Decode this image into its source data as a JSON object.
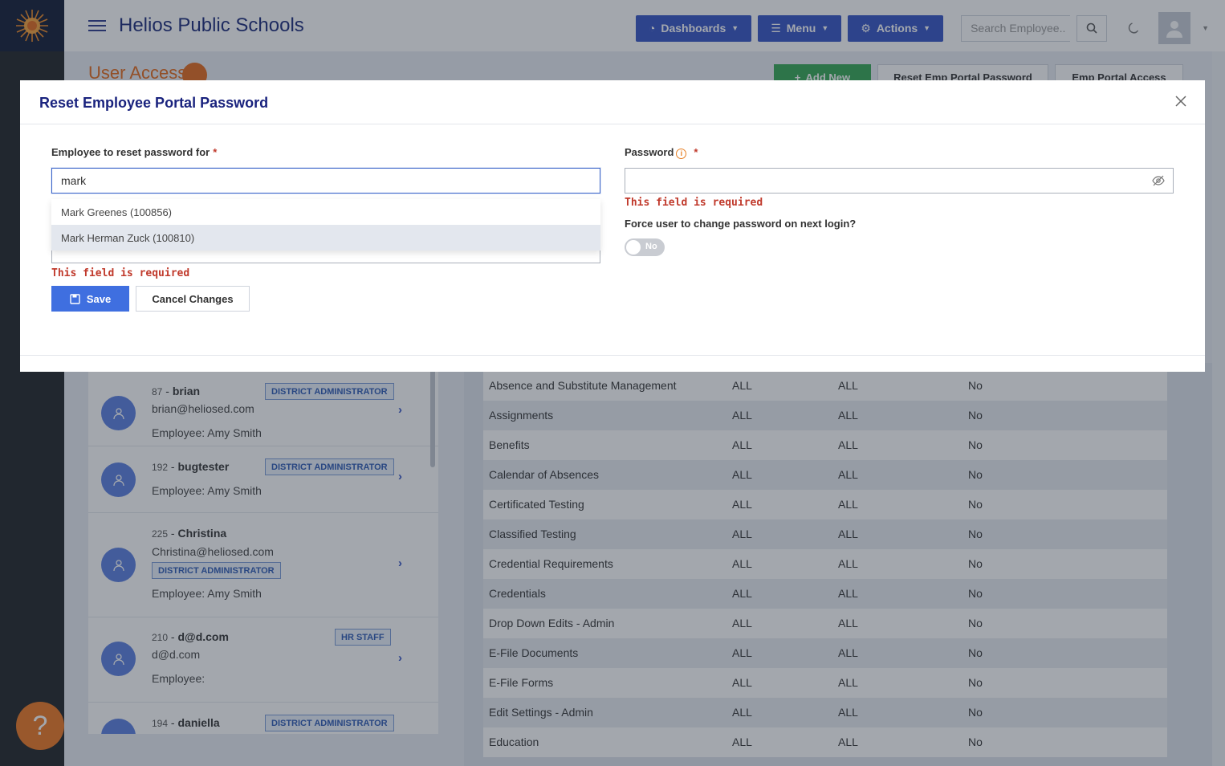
{
  "app": {
    "title": "Helios Public Schools",
    "logo_icon": "sun-logo-icon"
  },
  "topbar": {
    "dashboards_label": "Dashboards",
    "menu_label": "Menu",
    "actions_label": "Actions",
    "search_placeholder": "Search Employee..",
    "accent_color": "#3553c4"
  },
  "page": {
    "title": "User Access",
    "add_new_label": "Add New",
    "reset_portal_label": "Reset Emp Portal Password",
    "portal_access_label": "Emp Portal Access"
  },
  "users": [
    {
      "num": "87",
      "name": "brian",
      "email": "brian@heliosed.com",
      "role": "DISTRICT ADMINISTRATOR",
      "employee": "Employee: Amy Smith"
    },
    {
      "num": "192",
      "name": "bugtester",
      "email": "",
      "role": "DISTRICT ADMINISTRATOR",
      "employee": "Employee: Amy Smith"
    },
    {
      "num": "225",
      "name": "Christina",
      "email": "Christina@heliosed.com",
      "role": "DISTRICT ADMINISTRATOR",
      "employee": "Employee: Amy Smith"
    },
    {
      "num": "210",
      "name": "d@d.com",
      "email": "d@d.com",
      "role": "HR STAFF",
      "employee": "Employee:"
    },
    {
      "num": "194",
      "name": "daniella",
      "email": "",
      "role": "DISTRICT ADMINISTRATOR",
      "employee": ""
    }
  ],
  "permissions": [
    [
      "Absence and Substitute Management",
      "ALL",
      "ALL",
      "No"
    ],
    [
      "Assignments",
      "ALL",
      "ALL",
      "No"
    ],
    [
      "Benefits",
      "ALL",
      "ALL",
      "No"
    ],
    [
      "Calendar of Absences",
      "ALL",
      "ALL",
      "No"
    ],
    [
      "Certificated Testing",
      "ALL",
      "ALL",
      "No"
    ],
    [
      "Classified Testing",
      "ALL",
      "ALL",
      "No"
    ],
    [
      "Credential Requirements",
      "ALL",
      "ALL",
      "No"
    ],
    [
      "Credentials",
      "ALL",
      "ALL",
      "No"
    ],
    [
      "Drop Down Edits - Admin",
      "ALL",
      "ALL",
      "No"
    ],
    [
      "E-File Documents",
      "ALL",
      "ALL",
      "No"
    ],
    [
      "E-File Forms",
      "ALL",
      "ALL",
      "No"
    ],
    [
      "Edit Settings - Admin",
      "ALL",
      "ALL",
      "No"
    ],
    [
      "Education",
      "ALL",
      "ALL",
      "No"
    ]
  ],
  "modal": {
    "title": "Reset Employee Portal Password",
    "employee_label": "Employee to reset password for",
    "employee_value": "mark",
    "password_label": "Password",
    "required_mark": "*",
    "info_glyph": "i",
    "password_value": "",
    "error_required": "This field is required",
    "force_change_label": "Force user to change password on next login?",
    "toggle_label": "No",
    "save_label": "Save",
    "cancel_label": "Cancel Changes",
    "dropdown_options": [
      "Mark Greenes (100856)",
      "Mark Herman Zuck (100810)"
    ]
  },
  "help": {
    "label": "?"
  }
}
